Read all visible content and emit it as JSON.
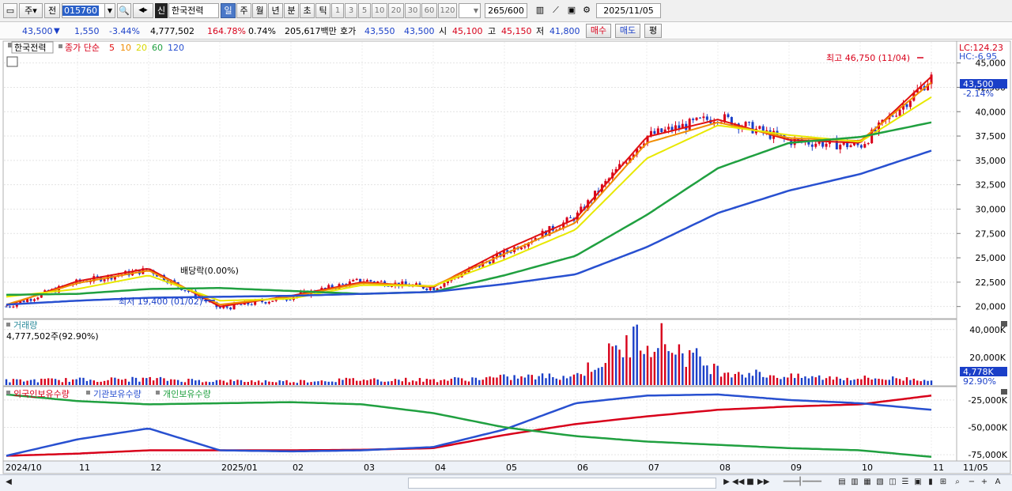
{
  "toolbar": {
    "type_label": "주",
    "prev_label": "전",
    "code_value": "015760",
    "badge_label": "신",
    "stock_name": "한국전력",
    "periods": [
      "일",
      "주",
      "월",
      "년",
      "분",
      "초",
      "틱"
    ],
    "active_period": "일",
    "minutes": [
      "1",
      "3",
      "5",
      "10",
      "20",
      "30",
      "60",
      "120"
    ],
    "count_value": "265",
    "count_total": "/600",
    "date_value": "2025/11/05"
  },
  "quote": {
    "price": "43,500",
    "arrow": "▼",
    "change": "1,550",
    "change_pct": "-3.44%",
    "volume": "4,777,502",
    "volume_ratio": "164.78%",
    "turnover": "0.74%",
    "amount": "205,617백만",
    "ask_label": "호가",
    "ask": "43,550",
    "bid": "43,500",
    "open_label": "시",
    "open": "45,100",
    "high_label": "고",
    "high": "45,150",
    "low_label": "저",
    "low": "41,800",
    "buy_label": "매수",
    "sell_label": "매도",
    "eval_label": "평"
  },
  "price_panel": {
    "title": "한국전력",
    "ma_label": "종가 단순",
    "ma_periods": [
      {
        "label": "5",
        "color": "#e01010"
      },
      {
        "label": "10",
        "color": "#f08c00"
      },
      {
        "label": "20",
        "color": "#e8e800"
      },
      {
        "label": "60",
        "color": "#20a040"
      },
      {
        "label": "120",
        "color": "#2850d0"
      }
    ],
    "lc_label": "LC:124.23",
    "hc_label": "HC:-6.95",
    "high_note": "최고 46,750 (11/04)",
    "low_note": "최저 19,400 (01/02)",
    "dividend_note": "배당락(0.00%)",
    "axis_labels": [
      "45,000",
      "42,500",
      "40,000",
      "37,500",
      "35,000",
      "32,500",
      "30,000",
      "27,500",
      "25,000",
      "22,500",
      "20,000"
    ],
    "current_price_tag": "43,500",
    "current_pct_tag": "-2.14%"
  },
  "volume_panel": {
    "title": "거래량",
    "value_text": "4,777,502주(92.90%)",
    "axis_labels": [
      "40,000K",
      "20,000K"
    ],
    "current_tag": "4,778K",
    "pct_tag": "92.90%"
  },
  "holding_panel": {
    "legend": [
      {
        "label": "외국인보유수량",
        "color": "#d8001a"
      },
      {
        "label": "기관보유수량",
        "color": "#2850d0"
      },
      {
        "label": "개인보유수량",
        "color": "#20a040"
      }
    ],
    "axis_labels": [
      "-25,000K",
      "-50,000K",
      "-75,000K"
    ]
  },
  "x_axis": {
    "labels": [
      "2024/10",
      "11",
      "12",
      "2025/01",
      "02",
      "03",
      "04",
      "05",
      "06",
      "07",
      "08",
      "09",
      "10",
      "11",
      "11/05"
    ]
  },
  "chart_data": [
    {
      "type": "candlestick",
      "title": "한국전력",
      "x": [
        "2024/10",
        "11",
        "12",
        "2025/01",
        "02",
        "03",
        "04",
        "05",
        "06",
        "07",
        "08",
        "09",
        "10",
        "11"
      ],
      "series": [
        {
          "name": "종가",
          "values": [
            20000,
            22500,
            23800,
            19800,
            21000,
            22700,
            21900,
            25500,
            29200,
            37500,
            39500,
            37000,
            36500,
            43500
          ]
        },
        {
          "name": "5",
          "values": [
            20100,
            22600,
            23900,
            20000,
            21100,
            22500,
            22000,
            25800,
            29000,
            37400,
            39200,
            37100,
            36800,
            43600
          ]
        },
        {
          "name": "10",
          "values": [
            20200,
            22400,
            23700,
            20200,
            21000,
            22400,
            22100,
            25400,
            28600,
            36800,
            38900,
            37300,
            37000,
            43000
          ]
        },
        {
          "name": "20",
          "values": [
            21000,
            21800,
            23200,
            20600,
            20800,
            22200,
            22100,
            24800,
            27900,
            35200,
            38600,
            37600,
            36900,
            41500
          ]
        },
        {
          "name": "60",
          "values": [
            21200,
            21300,
            21800,
            21900,
            21600,
            21300,
            21500,
            23200,
            25200,
            29400,
            34200,
            36800,
            37400,
            38900
          ]
        },
        {
          "name": "120",
          "values": [
            20200,
            20600,
            20900,
            21000,
            21100,
            21300,
            21500,
            22300,
            23300,
            26100,
            29600,
            31900,
            33600,
            36000
          ]
        }
      ],
      "ylim": [
        19000,
        47000
      ],
      "high": {
        "value": 46750,
        "date": "11/04"
      },
      "low": {
        "value": 19400,
        "date": "01/02"
      }
    },
    {
      "type": "bar",
      "title": "거래량",
      "x": [
        "2024/10",
        "11",
        "12",
        "2025/01",
        "02",
        "03",
        "04",
        "05",
        "06",
        "07",
        "08",
        "09",
        "10",
        "11"
      ],
      "values": [
        3500,
        4200,
        4800,
        3300,
        3000,
        4500,
        4000,
        6000,
        7500,
        42000,
        12000,
        6500,
        5500,
        4778
      ],
      "unit": "K",
      "ylim": [
        0,
        45000
      ]
    },
    {
      "type": "line",
      "x": [
        "2024/10",
        "11",
        "12",
        "2025/01",
        "02",
        "03",
        "04",
        "05",
        "06",
        "07",
        "08",
        "09",
        "10",
        "11"
      ],
      "series": [
        {
          "name": "외국인보유수량",
          "values": [
            -76000,
            -74000,
            -71000,
            -71000,
            -71000,
            -70500,
            -69000,
            -57000,
            -47000,
            -40000,
            -34000,
            -31000,
            -29000,
            -21000
          ]
        },
        {
          "name": "기관보유수량",
          "values": [
            -76000,
            -61000,
            -51000,
            -71000,
            -72000,
            -71000,
            -68000,
            -52000,
            -28000,
            -21000,
            -20000,
            -25000,
            -28000,
            -34000
          ]
        },
        {
          "name": "개인보유수량",
          "values": [
            -20000,
            -26000,
            -29000,
            -28000,
            -27000,
            -29000,
            -37000,
            -50000,
            -58000,
            -63000,
            -66000,
            -69000,
            -71000,
            -77000
          ]
        }
      ],
      "unit": "K",
      "ylim": [
        -80000,
        -15000
      ]
    }
  ]
}
